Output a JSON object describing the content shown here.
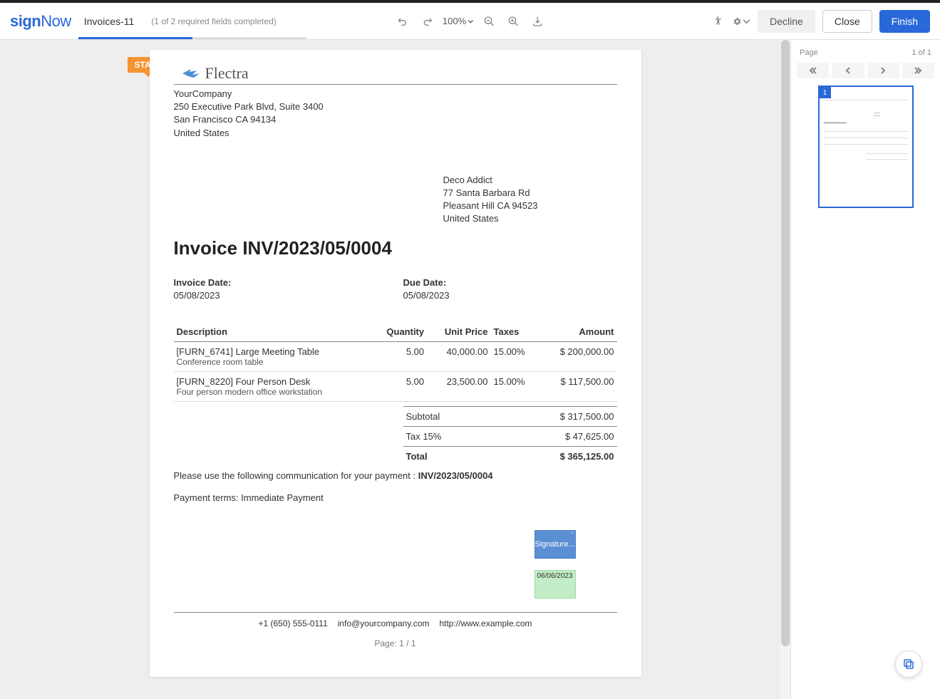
{
  "header": {
    "logo_sign": "sign",
    "logo_now": "Now",
    "doc_title": "Invoices-11",
    "progress_text": "(1 of 2 required fields completed)",
    "zoom": "100%",
    "btn_decline": "Decline",
    "btn_close": "Close",
    "btn_finish": "Finish"
  },
  "start_label": "START",
  "flectra": "Flectra",
  "company": {
    "name": "YourCompany",
    "addr1": "250 Executive Park Blvd, Suite 3400",
    "addr2": "San Francisco CA 94134",
    "country": "United States"
  },
  "customer": {
    "name": "Deco Addict",
    "addr1": "77 Santa Barbara Rd",
    "addr2": "Pleasant Hill CA 94523",
    "country": "United States"
  },
  "invoice_title": "Invoice INV/2023/05/0004",
  "dates": {
    "invoice_label": "Invoice Date:",
    "invoice_value": "05/08/2023",
    "due_label": "Due Date:",
    "due_value": "05/08/2023"
  },
  "table": {
    "h_desc": "Description",
    "h_qty": "Quantity",
    "h_unit": "Unit Price",
    "h_tax": "Taxes",
    "h_amt": "Amount",
    "rows": [
      {
        "desc": "[FURN_6741] Large Meeting Table",
        "sub": "Conference room table",
        "qty": "5.00",
        "unit": "40,000.00",
        "tax": "15.00%",
        "amt": "$ 200,000.00"
      },
      {
        "desc": "[FURN_8220] Four Person Desk",
        "sub": "Four person modern office workstation",
        "qty": "5.00",
        "unit": "23,500.00",
        "tax": "15.00%",
        "amt": "$ 117,500.00"
      }
    ]
  },
  "totals": {
    "subtotal_label": "Subtotal",
    "subtotal_value": "$ 317,500.00",
    "tax_label": "Tax 15%",
    "tax_value": "$ 47,625.00",
    "total_label": "Total",
    "total_value": "$ 365,125.00"
  },
  "comm_prefix": "Please use the following communication for your payment : ",
  "comm_ref": "INV/2023/05/0004",
  "terms": "Payment terms: Immediate Payment",
  "signature_label": "Signature...",
  "date_field_value": "06/06/2023",
  "footer": {
    "phone": "+1 (650) 555-0111",
    "email": "info@yourcompany.com",
    "url": "http://www.example.com",
    "page": "Page: 1 / 1"
  },
  "nav": {
    "page_label": "Page",
    "page_count": "1 of 1",
    "thumb_num": "1"
  }
}
